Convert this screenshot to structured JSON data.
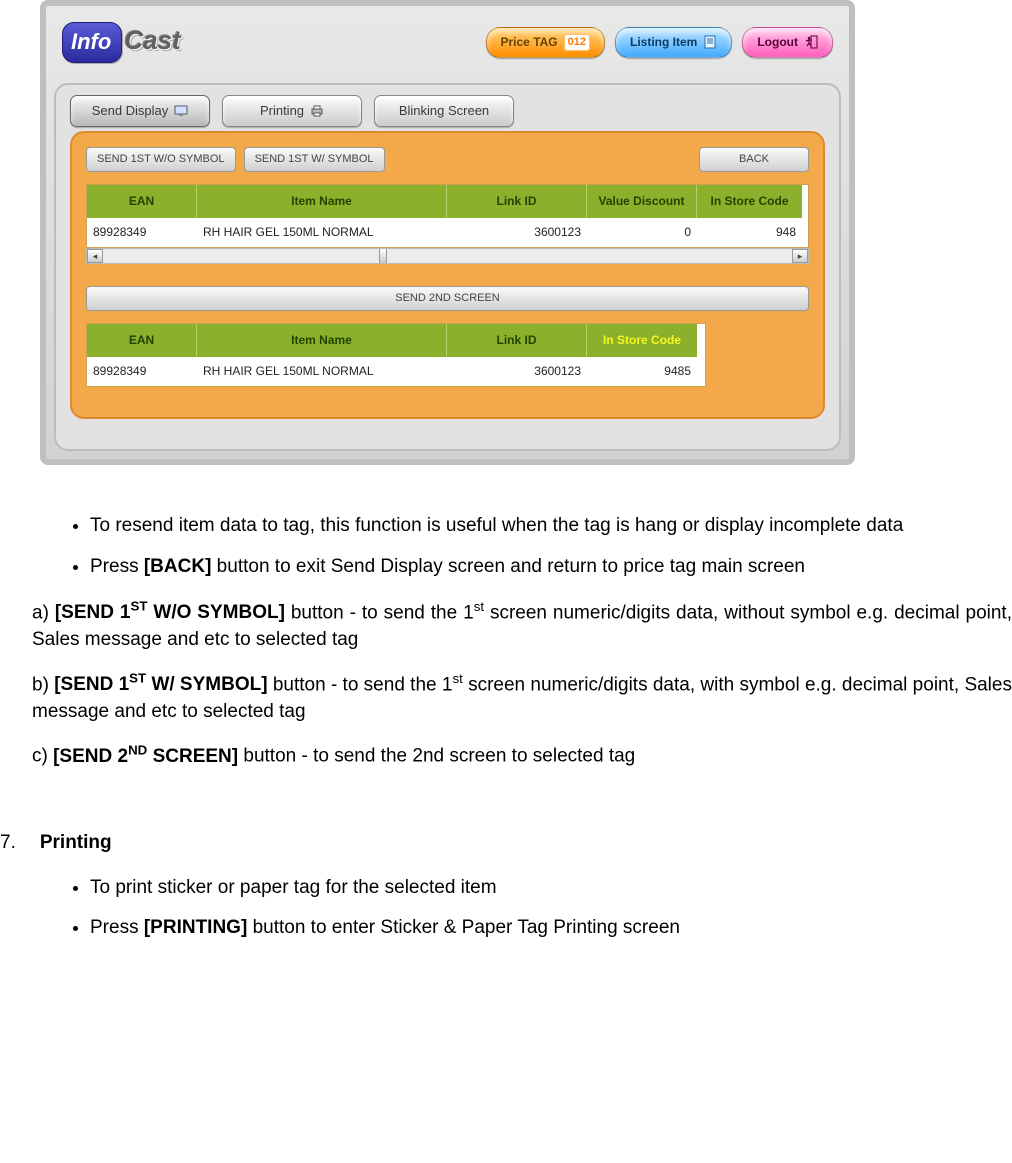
{
  "app": {
    "logo_info": "Info",
    "logo_cast": "Cast"
  },
  "pills": {
    "price_tag": "Price TAG",
    "price_tag_badge": "012",
    "listing_item": "Listing Item",
    "logout": "Logout"
  },
  "tabs": {
    "send_display": "Send Display",
    "printing": "Printing",
    "blinking": "Blinking Screen"
  },
  "buttons": {
    "send1_wo": "SEND 1ST W/O SYMBOL",
    "send1_w": "SEND 1ST W/ SYMBOL",
    "back": "BACK",
    "send2": "SEND 2ND SCREEN"
  },
  "table1": {
    "headers": {
      "ean": "EAN",
      "name": "Item Name",
      "link": "Link ID",
      "vdisc": "Value Discount",
      "store": "In Store Code"
    },
    "row": {
      "ean": "89928349",
      "name": "RH HAIR GEL 150ML NORMAL",
      "link": "3600123",
      "vdisc": "0",
      "store": "948"
    }
  },
  "table2": {
    "headers": {
      "ean": "EAN",
      "name": "Item Name",
      "link": "Link ID",
      "store": "In Store Code"
    },
    "row": {
      "ean": "89928349",
      "name": "RH HAIR GEL 150ML NORMAL",
      "link": "3600123",
      "store": "9485"
    }
  },
  "doc": {
    "b1": "To resend item data to tag, this function is useful when the tag is hang or display incomplete data",
    "b2_pre": "Press ",
    "b2_strong": "[BACK]",
    "b2_post": " button to exit Send Display screen and return to price tag main screen",
    "a_label": "a) ",
    "a_strong_1": "[SEND 1",
    "a_strong_sup": "ST",
    "a_strong_2": " W/O SYMBOL]",
    "a_mid": " button - to send the 1",
    "a_sup2": "st",
    "a_end": " screen numeric/digits data, without symbol e.g. decimal point, Sales message and etc to selected tag",
    "b_label": "b) ",
    "b_strong_1": "[SEND 1",
    "b_strong_sup": "ST",
    "b_strong_2": " W/ SYMBOL]",
    "b_mid": " button - to send the 1",
    "b_sup2": "st",
    "b_end": " screen numeric/digits data, with symbol e.g. decimal point, Sales message and etc to selected tag",
    "c_label": "c) ",
    "c_strong_1": "[SEND 2",
    "c_strong_sup": "ND",
    "c_strong_2": " SCREEN]",
    "c_end": " button - to send the 2nd screen to selected tag",
    "sec_num": "7.",
    "sec_title": "Printing",
    "p1": "To print sticker or paper tag for the selected item",
    "p2_pre": "Press ",
    "p2_strong": "[PRINTING]",
    "p2_post": " button to enter Sticker & Paper Tag Printing screen"
  }
}
